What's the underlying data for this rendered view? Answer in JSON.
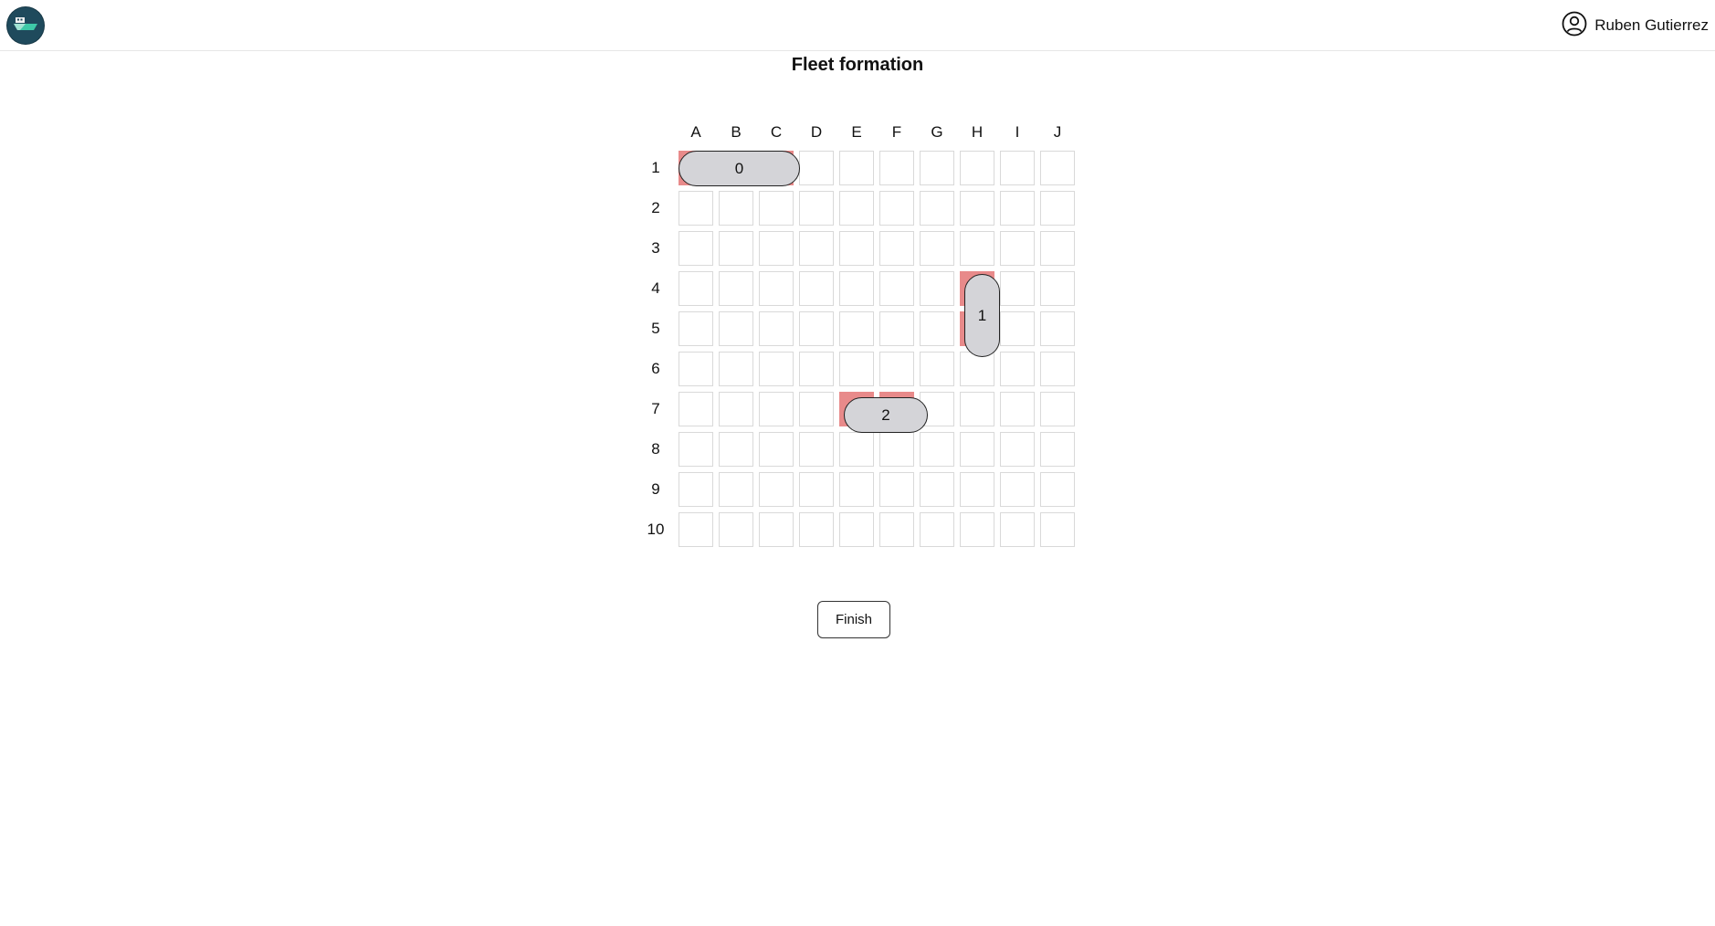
{
  "header": {
    "logo_icon": "ship-logo-icon",
    "user_icon": "user-circle-icon",
    "user_name": "Ruben Gutierrez"
  },
  "page": {
    "title": "Fleet formation"
  },
  "board": {
    "columns": [
      "A",
      "B",
      "C",
      "D",
      "E",
      "F",
      "G",
      "H",
      "I",
      "J"
    ],
    "rows": [
      "1",
      "2",
      "3",
      "4",
      "5",
      "6",
      "7",
      "8",
      "9",
      "10"
    ],
    "occupied_cells": [
      "A1",
      "B1",
      "C1",
      "H4",
      "H5",
      "E7",
      "F7"
    ],
    "ships": [
      {
        "label": "0",
        "cells": [
          "A1",
          "B1",
          "C1"
        ],
        "orientation": "horizontal"
      },
      {
        "label": "1",
        "cells": [
          "H4",
          "H5"
        ],
        "orientation": "vertical"
      },
      {
        "label": "2",
        "cells": [
          "E7",
          "F7"
        ],
        "orientation": "horizontal"
      }
    ]
  },
  "actions": {
    "finish_label": "Finish"
  },
  "colors": {
    "occupied": "#e88a8a",
    "ship_fill": "#d4d4d8",
    "logo_bg": "#1f4a5c"
  }
}
